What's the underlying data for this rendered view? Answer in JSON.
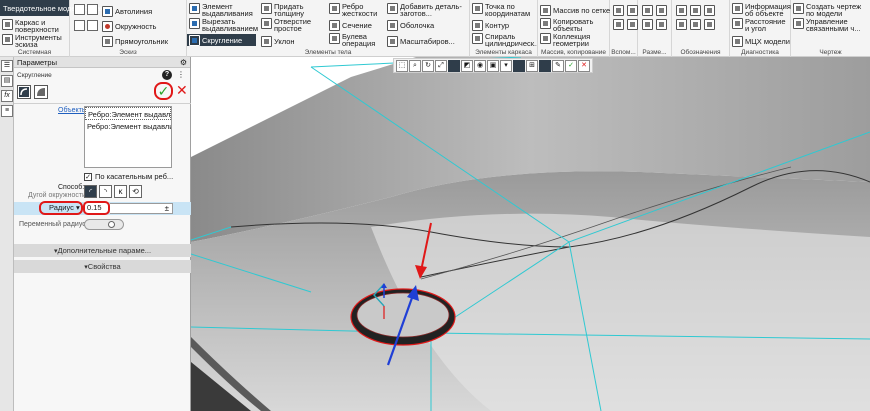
{
  "ribbon": {
    "tab_label": "Твердотельное моделирование",
    "tool_groups": [
      {
        "caption": "Системная",
        "items": [
          "Каркас и поверхности",
          "Инструменты эскиза"
        ]
      },
      {
        "caption": "Эскиз",
        "items": [
          "Автолиния",
          "Окружность",
          "Прямоугольник"
        ]
      },
      {
        "caption": "Элементы тела",
        "items": [
          "Элемент выдавливания",
          "Вырезать выдавливанием",
          "Скругление",
          "Придать толщину",
          "Отверстие простое",
          "Уклон",
          "Ребро жесткости",
          "Сечение",
          "Булева операция",
          "Добавить деталь-заготов...",
          "Оболочка",
          "Масштабиров..."
        ]
      },
      {
        "caption": "Элементы каркаса",
        "items": [
          "Точка по координатам",
          "Контур",
          "Спираль цилиндрическ..."
        ]
      },
      {
        "caption": "Массив, копирование",
        "items": [
          "Массив по сетке",
          "Копировать объекты",
          "Коллекция геометрии"
        ]
      },
      {
        "caption": "Вспом...",
        "items": []
      },
      {
        "caption": "Разме...",
        "items": []
      },
      {
        "caption": "Обозначения",
        "items": []
      },
      {
        "caption": "Диагностика",
        "items": [
          "Информация об объекте",
          "Расстояние и угол",
          "МЦХ модели"
        ]
      },
      {
        "caption": "Чертеж",
        "items": [
          "Создать чертеж по модели",
          "Управление связанными ч..."
        ]
      }
    ],
    "active_tool": "Скругление"
  },
  "sidebar": {
    "tabs": [
      "tree",
      "layers",
      "fx"
    ]
  },
  "panel": {
    "header": "Параметры",
    "command_title": "Скругление",
    "objects_label": "Объекты",
    "objects": [
      "Ребро:Элемент выдавли...",
      "Ребро:Элемент выдавли..."
    ],
    "tangent_label": "По касательным реб...",
    "tangent_checked": true,
    "method_label": "Способ:",
    "method_sub_label": "Дугой окружности",
    "radius_label": "Радиус",
    "radius_value": "0.15",
    "variable_radius_label": "Переменный радиус:",
    "sections": [
      "Дополнительные параме...",
      "Свойства"
    ]
  },
  "colors": {
    "accent": "#2f3d4a",
    "highlight": "#c9e4f5",
    "annotation": "#e01818",
    "ok": "#2aa52a",
    "edge_line": "#2fc9d2",
    "arrow_blue": "#1f3fd6"
  }
}
